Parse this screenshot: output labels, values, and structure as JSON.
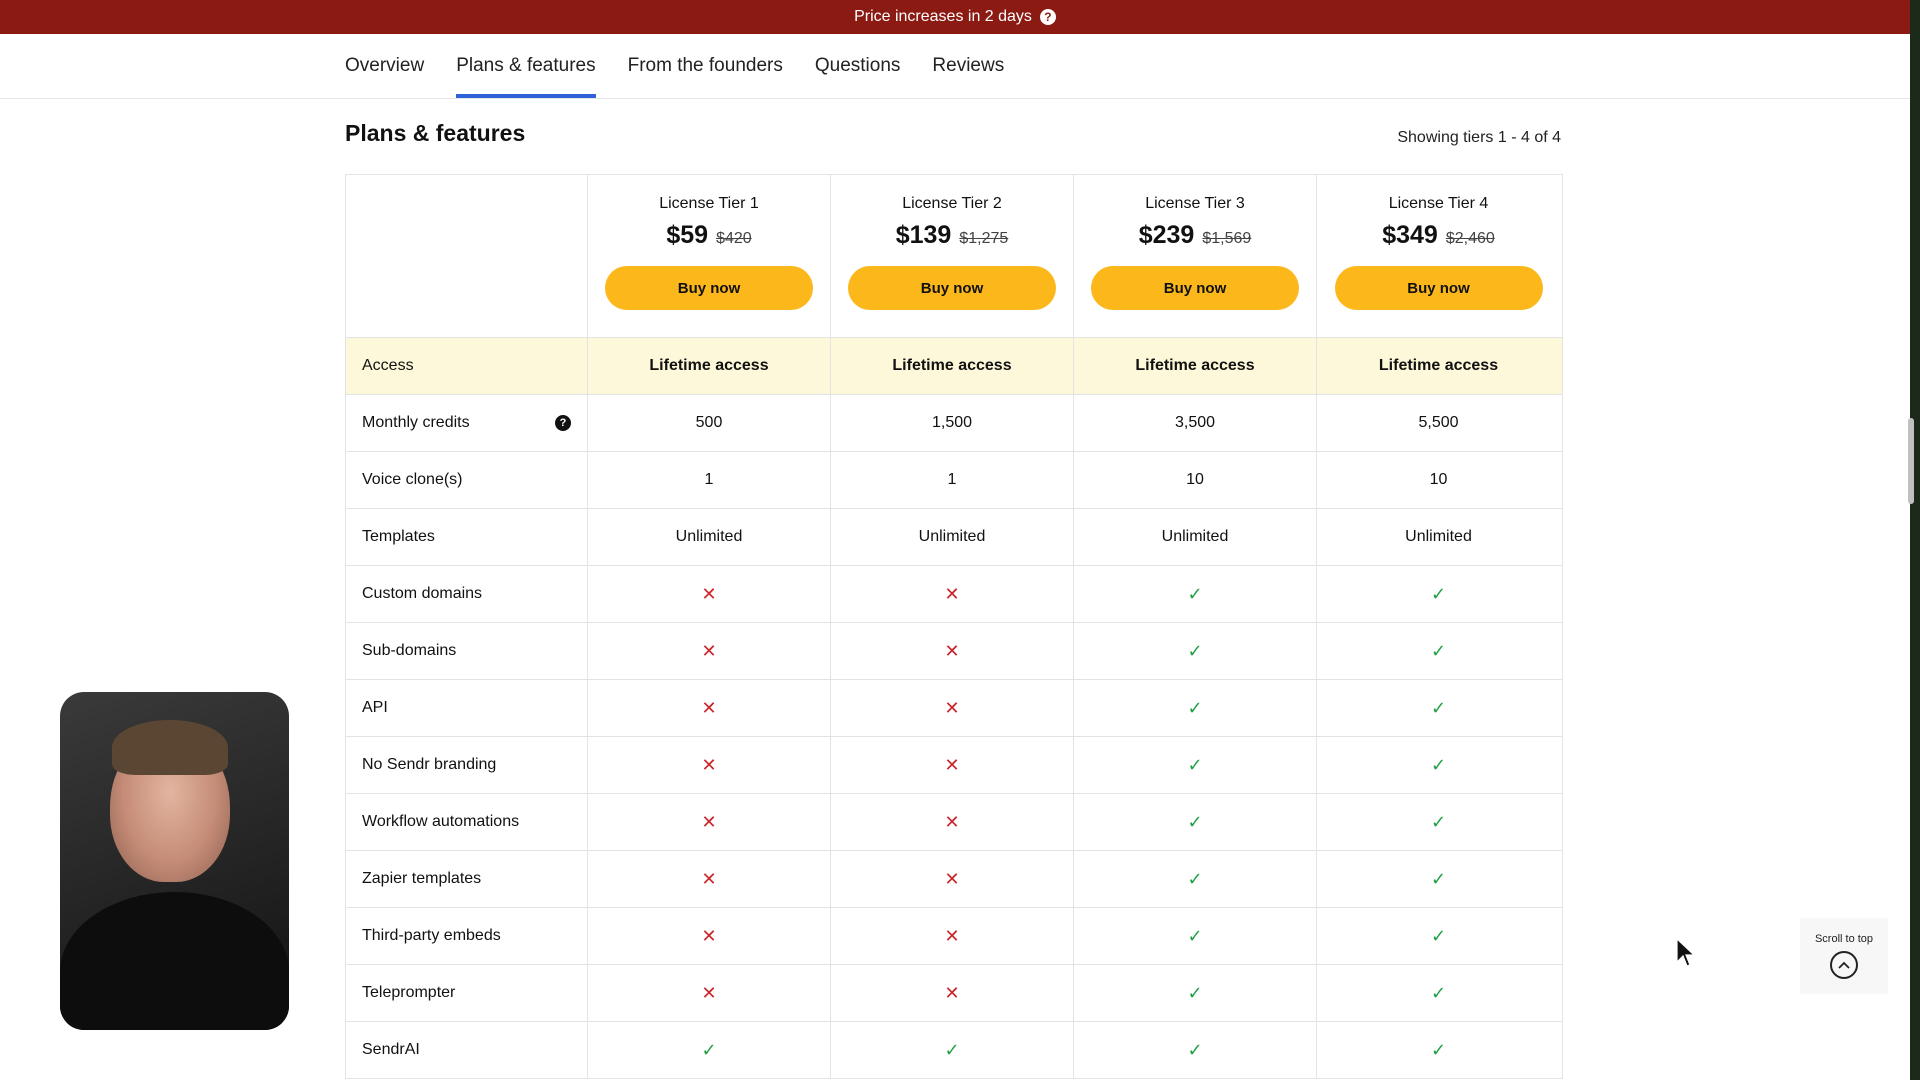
{
  "promo": {
    "text": "Price increases in 2 days",
    "help_icon": "question-icon"
  },
  "tabs": [
    {
      "label": "Overview",
      "active": false
    },
    {
      "label": "Plans & features",
      "active": true
    },
    {
      "label": "From the founders",
      "active": false
    },
    {
      "label": "Questions",
      "active": false
    },
    {
      "label": "Reviews",
      "active": false
    }
  ],
  "section": {
    "title": "Plans & features",
    "count": "Showing tiers 1 - 4 of 4"
  },
  "tiers": [
    {
      "name": "License Tier 1",
      "price": "$59",
      "original": "$420",
      "buy_label": "Buy now"
    },
    {
      "name": "License Tier 2",
      "price": "$139",
      "original": "$1,275",
      "buy_label": "Buy now"
    },
    {
      "name": "License Tier 3",
      "price": "$239",
      "original": "$1,569",
      "buy_label": "Buy now"
    },
    {
      "name": "License Tier 4",
      "price": "$349",
      "original": "$2,460",
      "buy_label": "Buy now"
    }
  ],
  "features": [
    {
      "label": "Access",
      "values": [
        "Lifetime access",
        "Lifetime access",
        "Lifetime access",
        "Lifetime access"
      ]
    },
    {
      "label": "Monthly credits",
      "values": [
        "500",
        "1,500",
        "3,500",
        "5,500"
      ]
    },
    {
      "label": "Voice clone(s)",
      "values": [
        "1",
        "1",
        "10",
        "10"
      ]
    },
    {
      "label": "Templates",
      "values": [
        "Unlimited",
        "Unlimited",
        "Unlimited",
        "Unlimited"
      ]
    },
    {
      "label": "Custom domains",
      "values": [
        "✕",
        "✕",
        "✓",
        "✓"
      ]
    },
    {
      "label": "Sub-domains",
      "values": [
        "✕",
        "✕",
        "✓",
        "✓"
      ]
    },
    {
      "label": "API",
      "values": [
        "✕",
        "✕",
        "✓",
        "✓"
      ]
    },
    {
      "label": "No Sendr branding",
      "values": [
        "✕",
        "✕",
        "✓",
        "✓"
      ]
    },
    {
      "label": "Workflow automations",
      "values": [
        "✕",
        "✕",
        "✓",
        "✓"
      ]
    },
    {
      "label": "Zapier templates",
      "values": [
        "✕",
        "✕",
        "✓",
        "✓"
      ]
    },
    {
      "label": "Third-party embeds",
      "values": [
        "✕",
        "✕",
        "✓",
        "✓"
      ]
    },
    {
      "label": "Teleprompter",
      "values": [
        "✕",
        "✕",
        "✓",
        "✓"
      ]
    },
    {
      "label": "SendrAI",
      "values": [
        "✓",
        "✓",
        "✓",
        "✓"
      ]
    }
  ],
  "scroll_top": {
    "label": "Scroll to top",
    "icon": "chevron-up-icon"
  },
  "colors": {
    "promo_bg": "#8b1a13",
    "accent_tab": "#2f62d8",
    "buy_button": "#fcb81b",
    "cross": "#c8262c",
    "check": "#22a046",
    "access_row": "#fdf8d9"
  }
}
